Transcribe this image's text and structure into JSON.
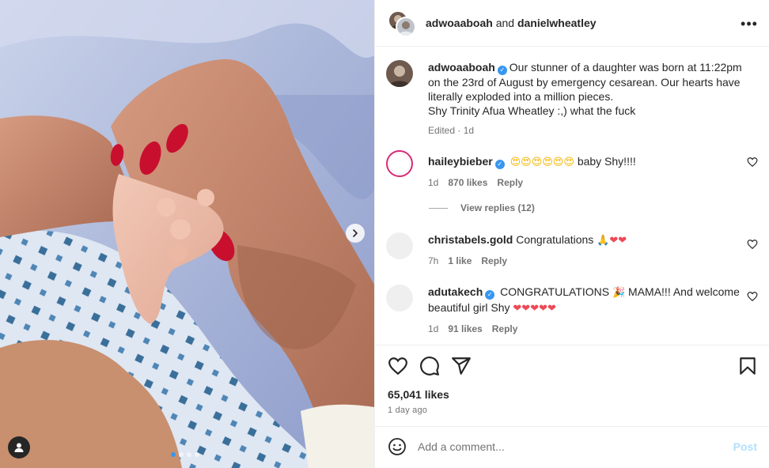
{
  "header": {
    "user1": "adwoaaboah",
    "and": "and",
    "user2": "danielwheatley"
  },
  "caption": {
    "username": "adwoaaboah",
    "text": "Our stunner of a daughter was born at 11:22pm on the 23rd of August by emergency cesarean. Our hearts have literally exploded into a million pieces.",
    "text2": "Shy Trinity Afua Wheatley :,) what the fuck",
    "edited": "Edited",
    "sep": "·",
    "time": "1d"
  },
  "comments": [
    {
      "username": "haileybieber",
      "emojis": "😍😍😍😍😍😍",
      "text": "baby Shy!!!!",
      "time": "1d",
      "likes": "870 likes",
      "reply": "Reply",
      "view_replies": "View replies (12)"
    },
    {
      "username": "christabels.gold",
      "text": "Congratulations",
      "emojis_hands": "🙏",
      "emojis_hearts": "❤❤",
      "time": "7h",
      "likes": "1 like",
      "reply": "Reply"
    },
    {
      "username": "adutakech",
      "text_pre": "CONGRATULATIONS",
      "emoji_party": "🎉",
      "text_post": "MAMA!!! And welcome beautiful girl Shy",
      "emojis_hearts": "❤❤❤❤❤",
      "time": "1d",
      "likes": "91 likes",
      "reply": "Reply"
    }
  ],
  "actions": {
    "like_icon": "heart-icon",
    "comment_icon": "comment-icon",
    "share_icon": "share-icon",
    "save_icon": "bookmark-icon",
    "likes": "65,041 likes",
    "time": "1 day ago"
  },
  "composer": {
    "placeholder": "Add a comment...",
    "post": "Post"
  },
  "carousel": {
    "slides": 4,
    "current": 1
  },
  "colors": {
    "accent": "#3797f0",
    "post_disabled": "#b2dffc",
    "heart": "#ed4956"
  }
}
